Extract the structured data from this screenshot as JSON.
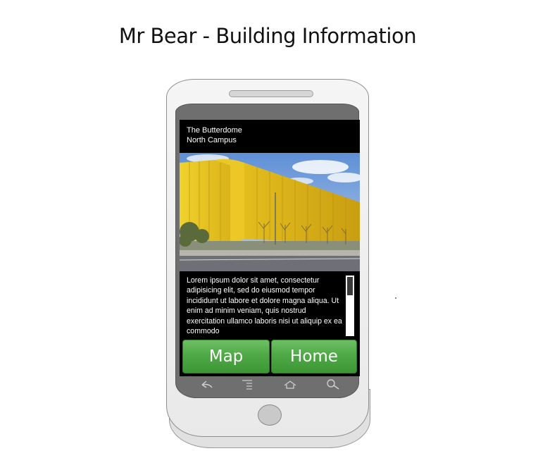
{
  "page": {
    "title": "Mr Bear - Building Information"
  },
  "header": {
    "building_name": "The Butterdome",
    "campus": "North Campus"
  },
  "photo": {
    "subject": "yellow building photo"
  },
  "description": {
    "text": "Lorem ipsum dolor sit amet, consectetur adipisicing elit, sed do eiusmod tempor incididunt ut labore et dolore magna aliqua. Ut enim ad minim veniam, quis nostrud exercitation ullamco laboris nisi ut aliquip ex ea commodo"
  },
  "buttons": {
    "map_label": "Map",
    "home_label": "Home"
  },
  "navbar": {
    "icons": [
      "back-icon",
      "menu-icon",
      "home-icon",
      "search-icon"
    ]
  },
  "colors": {
    "button_green": "#4fa946",
    "screen_background": "#000000",
    "building_yellow": "#e6c31e"
  }
}
